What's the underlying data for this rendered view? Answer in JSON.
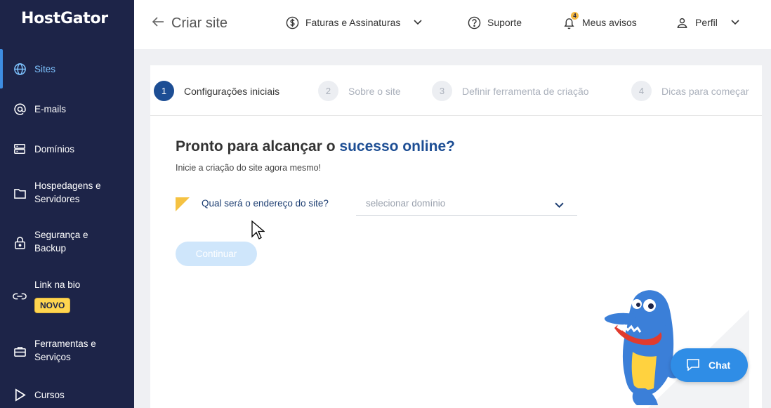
{
  "brand": {
    "logo": "HostGator"
  },
  "sidebar": {
    "items": [
      {
        "label": "Sites",
        "icon": "globe-icon",
        "active": true
      },
      {
        "label": "E-mails",
        "icon": "at-icon"
      },
      {
        "label": "Domínios",
        "icon": "server-icon"
      },
      {
        "label": "Hospedagens e\nServidores",
        "icon": "folder-icon"
      },
      {
        "label": "Segurança e\nBackup",
        "icon": "lock-icon"
      },
      {
        "label": "Link na bio",
        "icon": "link-icon",
        "badge": "NOVO"
      },
      {
        "label": "Ferramentas e\nServiços",
        "icon": "toolbox-icon"
      },
      {
        "label": "Cursos",
        "icon": "play-icon"
      }
    ]
  },
  "header": {
    "back_label": "Criar site",
    "billing_label": "Faturas e Assinaturas",
    "support_label": "Suporte",
    "notices_label": "Meus avisos",
    "notices_count": "4",
    "profile_label": "Perfil"
  },
  "steps": [
    {
      "num": "1",
      "label": "Configurações iniciais",
      "current": true
    },
    {
      "num": "2",
      "label": "Sobre o site"
    },
    {
      "num": "3",
      "label": "Definir ferramenta de criação"
    },
    {
      "num": "4",
      "label": "Dicas para começar"
    }
  ],
  "main": {
    "title_prefix": "Pronto para alcançar o ",
    "title_highlight": "sucesso online?",
    "subtitle": "Inicie a criação do site agora mesmo!",
    "question": "Qual será o endereço do site?",
    "domain_placeholder": "selecionar domínio",
    "continue_label": "Continuar"
  },
  "chat": {
    "label": "Chat"
  },
  "colors": {
    "sidebar": "#1d2448",
    "accent": "#1d4e94",
    "chat": "#2f8de6",
    "badge": "#ffd54f"
  }
}
